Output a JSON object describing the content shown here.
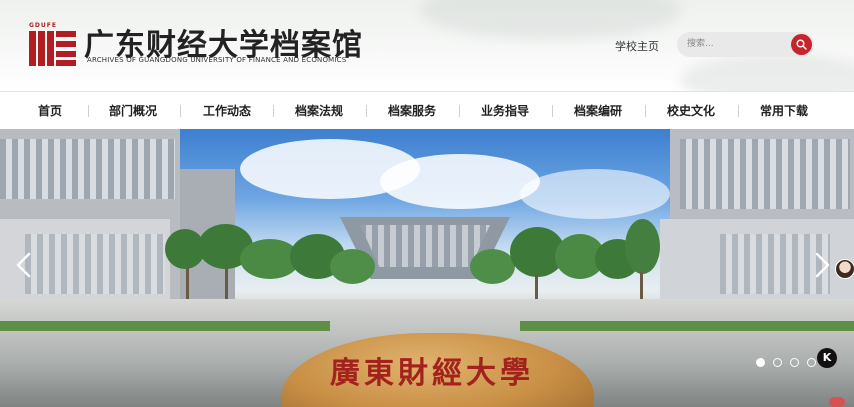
{
  "header": {
    "logo_mark_text": "GDUFE",
    "title_cn": "广东财经大学档案馆",
    "title_en": "ARCHIVES OF GUANGDONG UNIVERSITY OF FINANCE AND ECONOMICS",
    "home_link": "学校主页",
    "search_placeholder": "搜索..."
  },
  "nav": {
    "items": [
      "首页",
      "部门概况",
      "工作动态",
      "档案法规",
      "档案服务",
      "业务指导",
      "档案编研",
      "校史文化",
      "常用下载"
    ]
  },
  "banner": {
    "rock_text": "廣東財經大學",
    "slide_count": 4,
    "active_slide": 1,
    "badge_text": "K"
  },
  "colors": {
    "brand_red": "#c8242b",
    "nav_text": "#222222"
  }
}
